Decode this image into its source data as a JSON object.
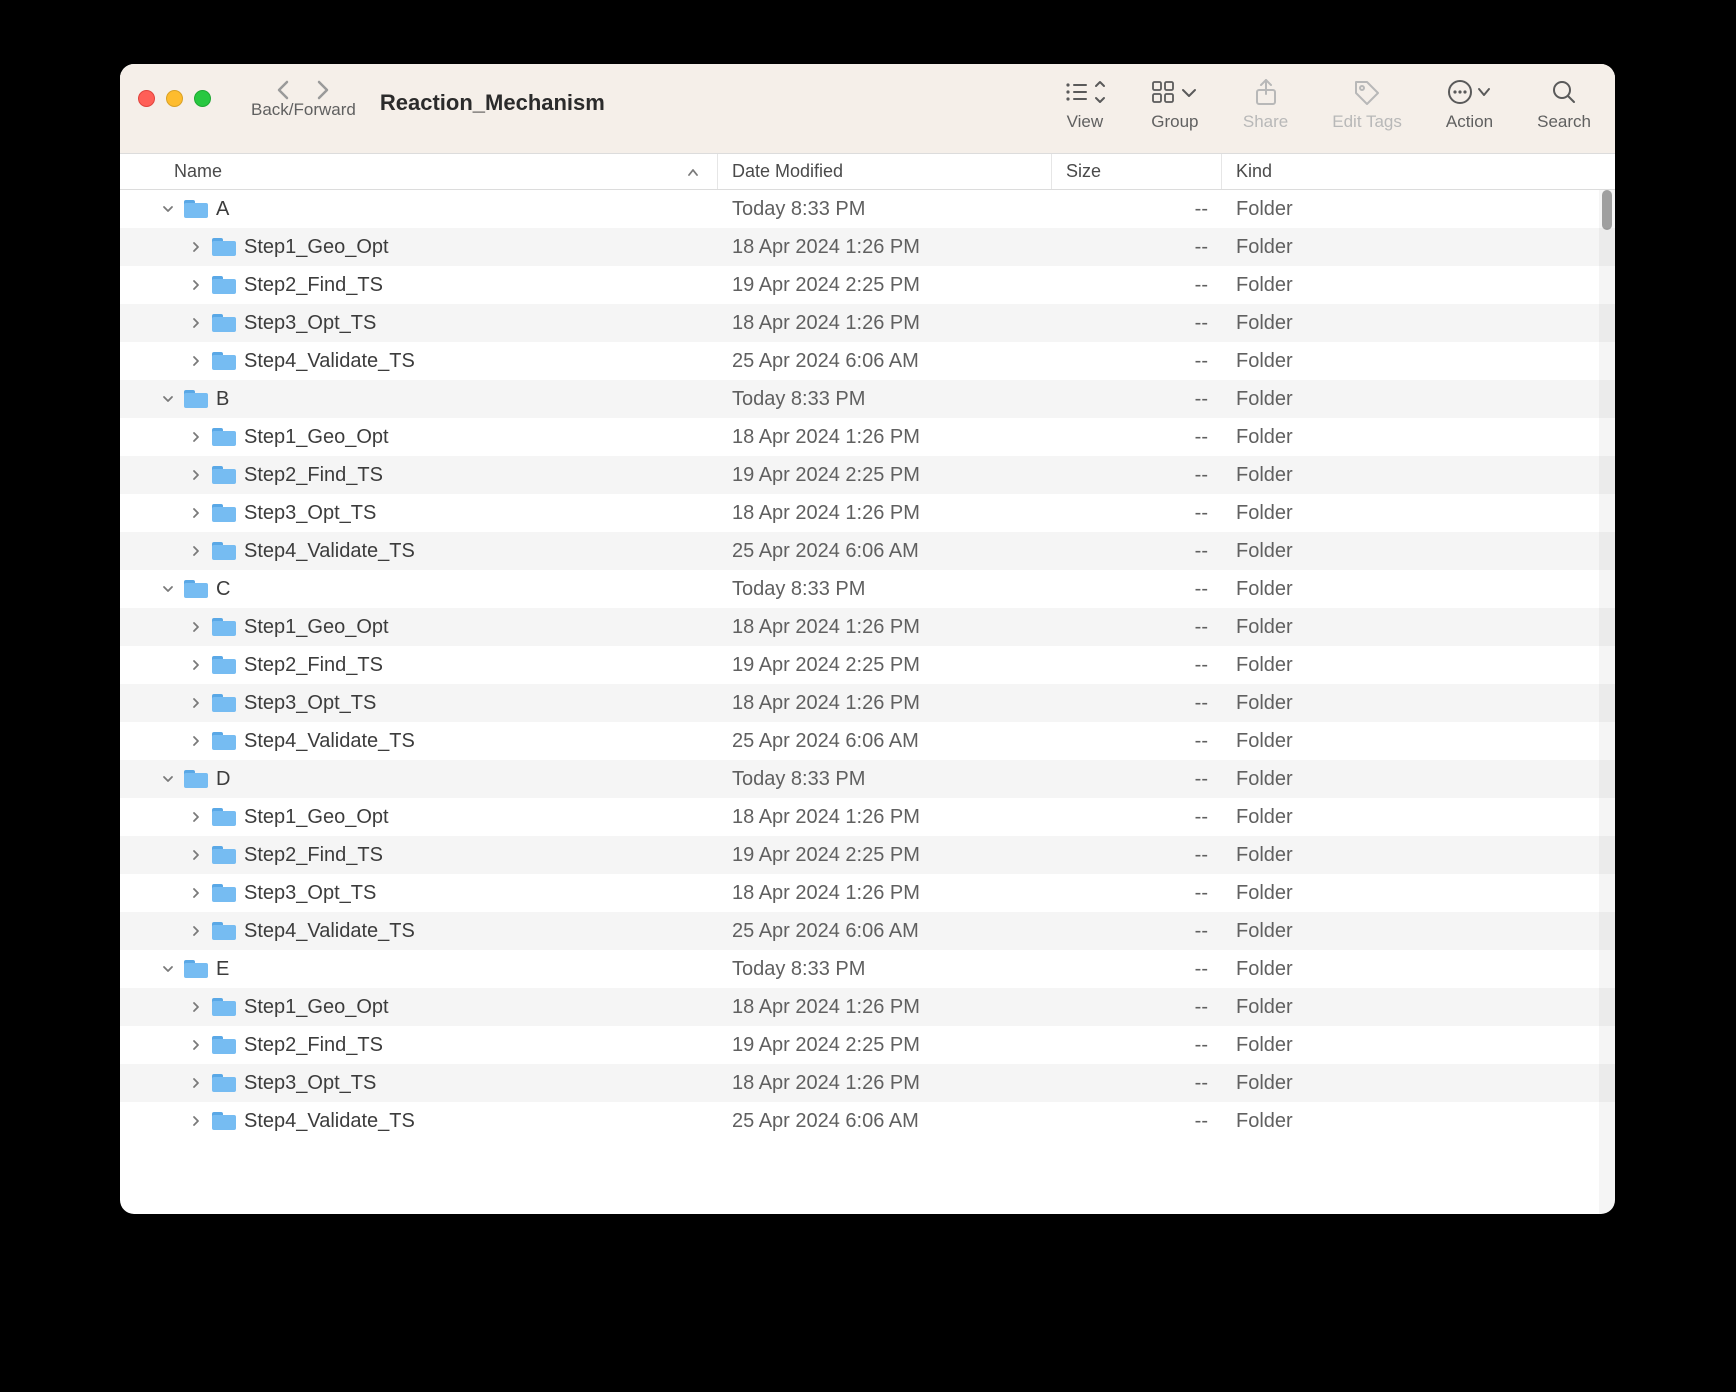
{
  "window_title": "Reaction_Mechanism",
  "toolbar": {
    "back_forward_label": "Back/Forward",
    "view_label": "View",
    "group_label": "Group",
    "share_label": "Share",
    "edit_tags_label": "Edit Tags",
    "action_label": "Action",
    "search_label": "Search"
  },
  "columns": {
    "name": "Name",
    "date_modified": "Date Modified",
    "size": "Size",
    "kind": "Kind"
  },
  "rows": [
    {
      "level": 1,
      "expanded": true,
      "name": "A",
      "date": "Today 8:33 PM",
      "size": "--",
      "kind": "Folder"
    },
    {
      "level": 2,
      "expanded": false,
      "name": "Step1_Geo_Opt",
      "date": "18 Apr 2024 1:26 PM",
      "size": "--",
      "kind": "Folder"
    },
    {
      "level": 2,
      "expanded": false,
      "name": "Step2_Find_TS",
      "date": "19 Apr 2024 2:25 PM",
      "size": "--",
      "kind": "Folder"
    },
    {
      "level": 2,
      "expanded": false,
      "name": "Step3_Opt_TS",
      "date": "18 Apr 2024 1:26 PM",
      "size": "--",
      "kind": "Folder"
    },
    {
      "level": 2,
      "expanded": false,
      "name": "Step4_Validate_TS",
      "date": "25 Apr 2024 6:06 AM",
      "size": "--",
      "kind": "Folder"
    },
    {
      "level": 1,
      "expanded": true,
      "name": "B",
      "date": "Today 8:33 PM",
      "size": "--",
      "kind": "Folder"
    },
    {
      "level": 2,
      "expanded": false,
      "name": "Step1_Geo_Opt",
      "date": "18 Apr 2024 1:26 PM",
      "size": "--",
      "kind": "Folder"
    },
    {
      "level": 2,
      "expanded": false,
      "name": "Step2_Find_TS",
      "date": "19 Apr 2024 2:25 PM",
      "size": "--",
      "kind": "Folder"
    },
    {
      "level": 2,
      "expanded": false,
      "name": "Step3_Opt_TS",
      "date": "18 Apr 2024 1:26 PM",
      "size": "--",
      "kind": "Folder"
    },
    {
      "level": 2,
      "expanded": false,
      "name": "Step4_Validate_TS",
      "date": "25 Apr 2024 6:06 AM",
      "size": "--",
      "kind": "Folder"
    },
    {
      "level": 1,
      "expanded": true,
      "name": "C",
      "date": "Today 8:33 PM",
      "size": "--",
      "kind": "Folder"
    },
    {
      "level": 2,
      "expanded": false,
      "name": "Step1_Geo_Opt",
      "date": "18 Apr 2024 1:26 PM",
      "size": "--",
      "kind": "Folder"
    },
    {
      "level": 2,
      "expanded": false,
      "name": "Step2_Find_TS",
      "date": "19 Apr 2024 2:25 PM",
      "size": "--",
      "kind": "Folder"
    },
    {
      "level": 2,
      "expanded": false,
      "name": "Step3_Opt_TS",
      "date": "18 Apr 2024 1:26 PM",
      "size": "--",
      "kind": "Folder"
    },
    {
      "level": 2,
      "expanded": false,
      "name": "Step4_Validate_TS",
      "date": "25 Apr 2024 6:06 AM",
      "size": "--",
      "kind": "Folder"
    },
    {
      "level": 1,
      "expanded": true,
      "name": "D",
      "date": "Today 8:33 PM",
      "size": "--",
      "kind": "Folder"
    },
    {
      "level": 2,
      "expanded": false,
      "name": "Step1_Geo_Opt",
      "date": "18 Apr 2024 1:26 PM",
      "size": "--",
      "kind": "Folder"
    },
    {
      "level": 2,
      "expanded": false,
      "name": "Step2_Find_TS",
      "date": "19 Apr 2024 2:25 PM",
      "size": "--",
      "kind": "Folder"
    },
    {
      "level": 2,
      "expanded": false,
      "name": "Step3_Opt_TS",
      "date": "18 Apr 2024 1:26 PM",
      "size": "--",
      "kind": "Folder"
    },
    {
      "level": 2,
      "expanded": false,
      "name": "Step4_Validate_TS",
      "date": "25 Apr 2024 6:06 AM",
      "size": "--",
      "kind": "Folder"
    },
    {
      "level": 1,
      "expanded": true,
      "name": "E",
      "date": "Today 8:33 PM",
      "size": "--",
      "kind": "Folder"
    },
    {
      "level": 2,
      "expanded": false,
      "name": "Step1_Geo_Opt",
      "date": "18 Apr 2024 1:26 PM",
      "size": "--",
      "kind": "Folder"
    },
    {
      "level": 2,
      "expanded": false,
      "name": "Step2_Find_TS",
      "date": "19 Apr 2024 2:25 PM",
      "size": "--",
      "kind": "Folder"
    },
    {
      "level": 2,
      "expanded": false,
      "name": "Step3_Opt_TS",
      "date": "18 Apr 2024 1:26 PM",
      "size": "--",
      "kind": "Folder"
    },
    {
      "level": 2,
      "expanded": false,
      "name": "Step4_Validate_TS",
      "date": "25 Apr 2024 6:06 AM",
      "size": "--",
      "kind": "Folder"
    }
  ]
}
